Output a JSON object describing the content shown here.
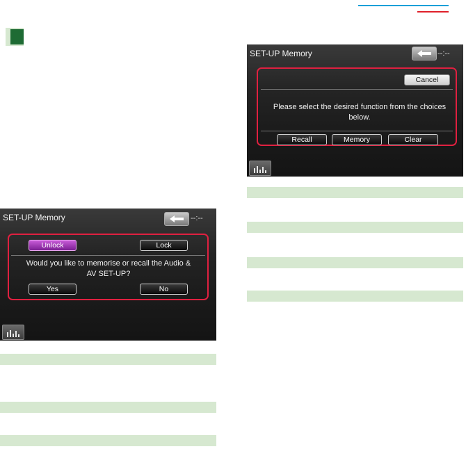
{
  "palette": {
    "accent_green": "#1e6b34",
    "bar_green": "#d6e8d0",
    "highlight_red": "#e02040",
    "rule_blue": "#1aa0d8",
    "rule_red": "#e0202a"
  },
  "left_screen": {
    "title": "SET-UP Memory",
    "clock": "--:--",
    "buttons": {
      "unlock": "Unlock",
      "lock": "Lock",
      "yes": "Yes",
      "no": "No"
    },
    "message": "Would you like to memorise or recall the Audio & AV SET-UP?",
    "icons": [
      "back-arrow-icon",
      "equalizer-icon"
    ]
  },
  "right_screen": {
    "title": "SET-UP Memory",
    "clock": "--:--",
    "buttons": {
      "cancel": "Cancel",
      "recall": "Recall",
      "memory": "Memory",
      "clear": "Clear"
    },
    "message": "Please select the desired function from the choices below.",
    "icons": [
      "back-arrow-icon",
      "equalizer-icon"
    ]
  }
}
